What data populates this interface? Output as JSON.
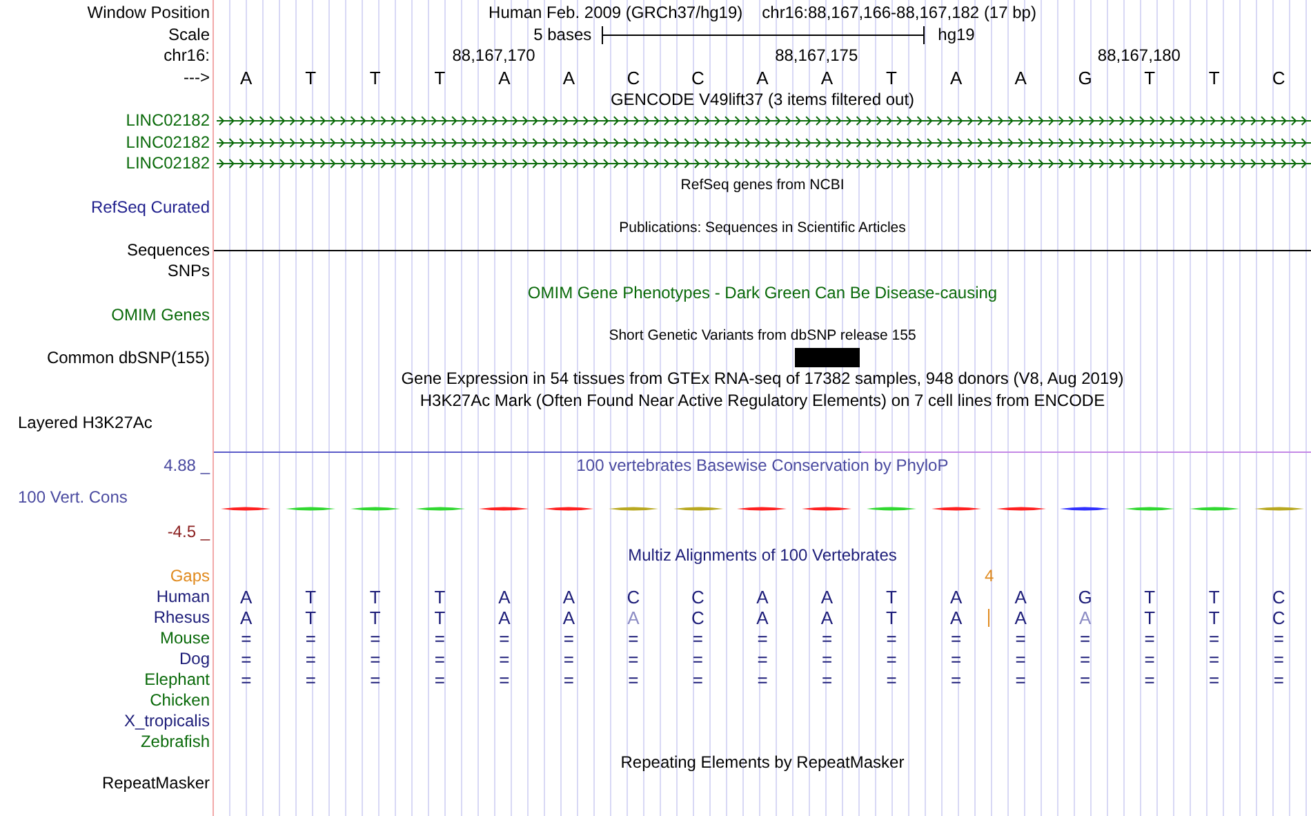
{
  "header": {
    "label": "Window Position",
    "assembly": "Human Feb. 2009 (GRCh37/hg19)",
    "position": "chr16:88,167,166-88,167,182 (17 bp)"
  },
  "scale": {
    "label": "Scale",
    "length": "5 bases",
    "assembly": "hg19"
  },
  "ruler": {
    "label": "chr16:"
  },
  "sequence": {
    "label": "--->",
    "bases": [
      {
        "base": "A"
      },
      {
        "base": "T"
      },
      {
        "base": "T"
      },
      {
        "base": "T"
      },
      {
        "base": "A",
        "tick": "88,167,170"
      },
      {
        "base": "A"
      },
      {
        "base": "C"
      },
      {
        "base": "C"
      },
      {
        "base": "A"
      },
      {
        "base": "A",
        "tick": "88,167,175"
      },
      {
        "base": "T"
      },
      {
        "base": "A"
      },
      {
        "base": "A"
      },
      {
        "base": "G"
      },
      {
        "base": "T",
        "tick": "88,167,180"
      },
      {
        "base": "T"
      },
      {
        "base": "C"
      }
    ]
  },
  "tracks": [
    {
      "kind": "title",
      "text": "GENCODE V49lift37 (3 items filtered out)",
      "color": "#000000"
    },
    {
      "kind": "gene",
      "label": "LINC02182",
      "color": "#0a6a0a"
    },
    {
      "kind": "gene",
      "label": "LINC02182",
      "color": "#0a6a0a"
    },
    {
      "kind": "gene",
      "label": "LINC02182",
      "color": "#0a6a0a"
    },
    {
      "kind": "small-title",
      "text": "RefSeq genes from NCBI",
      "color": "#000000"
    },
    {
      "kind": "label",
      "label": "RefSeq Curated",
      "color": "#1e1e8c"
    },
    {
      "kind": "small-title",
      "text": "Publications: Sequences in Scientific Articles",
      "color": "#000000"
    },
    {
      "kind": "line",
      "label": "Sequences",
      "color": "#000000"
    },
    {
      "kind": "label",
      "label": "SNPs",
      "color": "#000000"
    },
    {
      "kind": "title",
      "text": "OMIM Gene Phenotypes - Dark Green Can Be Disease-causing",
      "color": "#0a6a0a"
    },
    {
      "kind": "label",
      "label": "OMIM Genes",
      "color": "#0a6a0a"
    },
    {
      "kind": "small-title",
      "text": "Short Genetic Variants from dbSNP release 155",
      "color": "#000000"
    },
    {
      "kind": "variants",
      "label": "Common dbSNP(155)",
      "color": "#000000",
      "variants": [
        false,
        false,
        false,
        false,
        false,
        false,
        false,
        false,
        false,
        true,
        false,
        false,
        false,
        false,
        false,
        false,
        false
      ]
    },
    {
      "kind": "title",
      "text": "Gene Expression in 54 tissues from GTEx RNA-seq of 17382 samples, 948 donors (V8, Aug 2019)",
      "color": "#000000"
    },
    {
      "kind": "title",
      "text": "H3K27Ac Mark (Often Found Near Active Regulatory Elements) on 7 cell lines from ENCODE",
      "color": "#000000"
    },
    {
      "kind": "composite",
      "label": "Layered H3K27Ac",
      "color": "#000000"
    }
  ],
  "conservation": {
    "title": "100 vertebrates Basewise Conservation by PhyloP",
    "label": "100 Vert. Cons",
    "max": "4.88 _",
    "min": "-4.5 _",
    "marks": [
      {
        "color": "#ff2020"
      },
      {
        "color": "#30d830"
      },
      {
        "color": "#30d830"
      },
      {
        "color": "#30d830"
      },
      {
        "color": "#ff2020"
      },
      {
        "color": "#ff2020"
      },
      {
        "color": "#b8a820"
      },
      {
        "color": "#b8a820"
      },
      {
        "color": "#ff2020"
      },
      {
        "color": "#ff2020"
      },
      {
        "color": "#30d830"
      },
      {
        "color": "#ff2020"
      },
      {
        "color": "#ff2020"
      },
      {
        "color": "#3030ff"
      },
      {
        "color": "#30d830"
      },
      {
        "color": "#30d830"
      },
      {
        "color": "#b8a820"
      }
    ]
  },
  "multiz": {
    "title": "Multiz Alignments of 100 Vertebrates",
    "gaps_label": "Gaps",
    "species": [
      {
        "label": "Human",
        "color": "#1c1c78",
        "bases": [
          {
            "base": "A",
            "match": true
          },
          {
            "base": "T",
            "match": true
          },
          {
            "base": "T",
            "match": true
          },
          {
            "base": "T",
            "match": true
          },
          {
            "base": "A",
            "match": true
          },
          {
            "base": "A",
            "match": true
          },
          {
            "base": "C",
            "match": true
          },
          {
            "base": "C",
            "match": true
          },
          {
            "base": "A",
            "match": true
          },
          {
            "base": "A",
            "match": true
          },
          {
            "base": "T",
            "match": true
          },
          {
            "base": "A",
            "match": true
          },
          {
            "base": "A",
            "match": true
          },
          {
            "base": "G",
            "match": true
          },
          {
            "base": "T",
            "match": true
          },
          {
            "base": "T",
            "match": true
          },
          {
            "base": "C",
            "match": true
          }
        ]
      },
      {
        "label": "Rhesus",
        "color": "#1c1c78",
        "bases": [
          {
            "base": "A",
            "match": true
          },
          {
            "base": "T",
            "match": true
          },
          {
            "base": "T",
            "match": true
          },
          {
            "base": "T",
            "match": true
          },
          {
            "base": "A",
            "match": true
          },
          {
            "base": "A",
            "match": true
          },
          {
            "base": "A",
            "match": false
          },
          {
            "base": "C",
            "match": true
          },
          {
            "base": "A",
            "match": true
          },
          {
            "base": "A",
            "match": true
          },
          {
            "base": "T",
            "match": true
          },
          {
            "base": "A",
            "match": true,
            "insert": "4"
          },
          {
            "base": "A",
            "match": true
          },
          {
            "base": "A",
            "match": false
          },
          {
            "base": "T",
            "match": true
          },
          {
            "base": "T",
            "match": true
          },
          {
            "base": "C",
            "match": true
          }
        ]
      },
      {
        "label": "Mouse",
        "color": "#0a6a0a",
        "bases": [
          {
            "base": "=",
            "match": true
          },
          {
            "base": "=",
            "match": true
          },
          {
            "base": "=",
            "match": true
          },
          {
            "base": "=",
            "match": true
          },
          {
            "base": "=",
            "match": true
          },
          {
            "base": "=",
            "match": true
          },
          {
            "base": "=",
            "match": true
          },
          {
            "base": "=",
            "match": true
          },
          {
            "base": "=",
            "match": true
          },
          {
            "base": "=",
            "match": true
          },
          {
            "base": "=",
            "match": true
          },
          {
            "base": "=",
            "match": true
          },
          {
            "base": "=",
            "match": true
          },
          {
            "base": "=",
            "match": true
          },
          {
            "base": "=",
            "match": true
          },
          {
            "base": "=",
            "match": true
          },
          {
            "base": "=",
            "match": true
          }
        ]
      },
      {
        "label": "Dog",
        "color": "#1c1c78",
        "bases": [
          {
            "base": "=",
            "match": true
          },
          {
            "base": "=",
            "match": true
          },
          {
            "base": "=",
            "match": true
          },
          {
            "base": "=",
            "match": true
          },
          {
            "base": "=",
            "match": true
          },
          {
            "base": "=",
            "match": true
          },
          {
            "base": "=",
            "match": true
          },
          {
            "base": "=",
            "match": true
          },
          {
            "base": "=",
            "match": true
          },
          {
            "base": "=",
            "match": true
          },
          {
            "base": "=",
            "match": true
          },
          {
            "base": "=",
            "match": true
          },
          {
            "base": "=",
            "match": true
          },
          {
            "base": "=",
            "match": true
          },
          {
            "base": "=",
            "match": true
          },
          {
            "base": "=",
            "match": true
          },
          {
            "base": "=",
            "match": true
          }
        ]
      },
      {
        "label": "Elephant",
        "color": "#0a6a0a",
        "bases": [
          {
            "base": "=",
            "match": true
          },
          {
            "base": "=",
            "match": true
          },
          {
            "base": "=",
            "match": true
          },
          {
            "base": "=",
            "match": true
          },
          {
            "base": "=",
            "match": true
          },
          {
            "base": "=",
            "match": true
          },
          {
            "base": "=",
            "match": true
          },
          {
            "base": "=",
            "match": true
          },
          {
            "base": "=",
            "match": true
          },
          {
            "base": "=",
            "match": true
          },
          {
            "base": "=",
            "match": true
          },
          {
            "base": "=",
            "match": true
          },
          {
            "base": "=",
            "match": true
          },
          {
            "base": "=",
            "match": true
          },
          {
            "base": "=",
            "match": true
          },
          {
            "base": "=",
            "match": true
          },
          {
            "base": "=",
            "match": true
          }
        ]
      },
      {
        "label": "Chicken",
        "color": "#0a6a0a"
      },
      {
        "label": "X_tropicalis",
        "color": "#1c1c78"
      },
      {
        "label": "Zebrafish",
        "color": "#0a6a0a"
      }
    ]
  },
  "repeats": {
    "title": "Repeating Elements by RepeatMasker",
    "label": "RepeatMasker"
  }
}
